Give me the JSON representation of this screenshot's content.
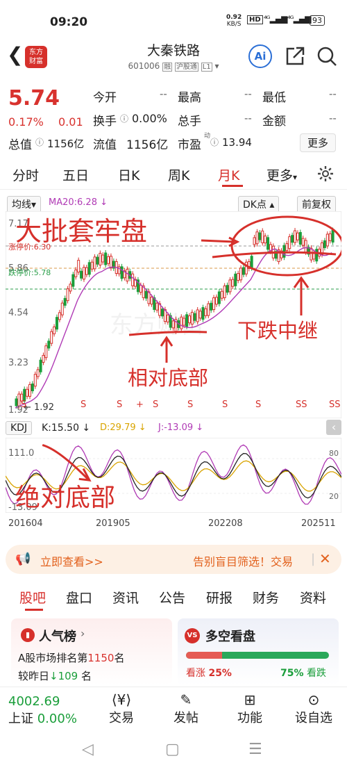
{
  "status": {
    "time": "09:20",
    "net_speed": "0.92",
    "net_unit": "KB/S",
    "battery": "93"
  },
  "header": {
    "title": "大秦铁路",
    "code": "601006",
    "tag_rong": "融",
    "tag_hgt": "沪股通",
    "tag_level": "L1"
  },
  "quote": {
    "price": "5.74",
    "pct": "0.17%",
    "chg": "0.01",
    "labels": {
      "open": "今开",
      "high": "最高",
      "low": "最低",
      "turnover": "换手",
      "volume": "总手",
      "amount": "金额",
      "total_value": "总值",
      "float_value": "流值",
      "pe": "市盈"
    },
    "values": {
      "open": "--",
      "high": "--",
      "low": "--",
      "turnover": "0.00%",
      "volume": "--",
      "amount": "--",
      "total_value": "1156亿",
      "float_value": "1156亿",
      "pe": "13.94"
    },
    "pe_sup": "动",
    "more": "更多"
  },
  "period_tabs": [
    "分时",
    "五日",
    "日K",
    "周K",
    "月K",
    "更多"
  ],
  "active_tab": "月K",
  "chart": {
    "ma_label": "均线",
    "ma20": "MA20:6.28 ↓",
    "dk_label": "DK点",
    "adjust_label": "前复权",
    "y_ticks": [
      "7.17",
      "5.86",
      "4.54",
      "3.23"
    ],
    "low_tick": "1.92",
    "low_point": "1.92",
    "limit_up": "涨停价:6.30",
    "limit_down": "跌停价:5.78",
    "kdj_label": "KDJ",
    "k": "K:15.50 ↓",
    "d": "D:29.79 ↓",
    "j": "J:-13.09 ↓",
    "kdj_ticks": [
      "111.0",
      "80",
      "20",
      "-13.09"
    ],
    "x_ticks": [
      "201604",
      "201905",
      "202208",
      "202511"
    ],
    "signals": [
      "S",
      "S",
      "S",
      "+",
      "S",
      "S",
      "S",
      "S",
      "SS",
      "SS"
    ],
    "watermark": "东方财富",
    "annotations": {
      "top": "大批套牢盘",
      "mid": "下跌中继",
      "bottom1": "相对底部",
      "bottom2": "绝对底部"
    }
  },
  "banner": {
    "left": "立即查看>>",
    "right": "告别盲目筛选！交易"
  },
  "info_tabs": [
    "股吧",
    "盘口",
    "资讯",
    "公告",
    "研报",
    "财务",
    "资料"
  ],
  "active_info_tab": "股吧",
  "popular": {
    "title": "人气榜",
    "rank_prefix": "A股市场排名第",
    "rank": "1150",
    "rank_suffix": "名",
    "change_prefix": "较昨日",
    "change": "109",
    "change_suffix": "名"
  },
  "sentiment": {
    "title": "多空看盘",
    "bull_label": "看涨",
    "bull_pct": "25%",
    "bear_pct": "75%",
    "bear_label": "看跌",
    "bull_fraction": 0.25
  },
  "bottom": {
    "index_value": "4002.69",
    "index_name": "上证",
    "index_pct": "0.00%",
    "items": [
      "交易",
      "发帖",
      "功能",
      "设自选"
    ]
  }
}
